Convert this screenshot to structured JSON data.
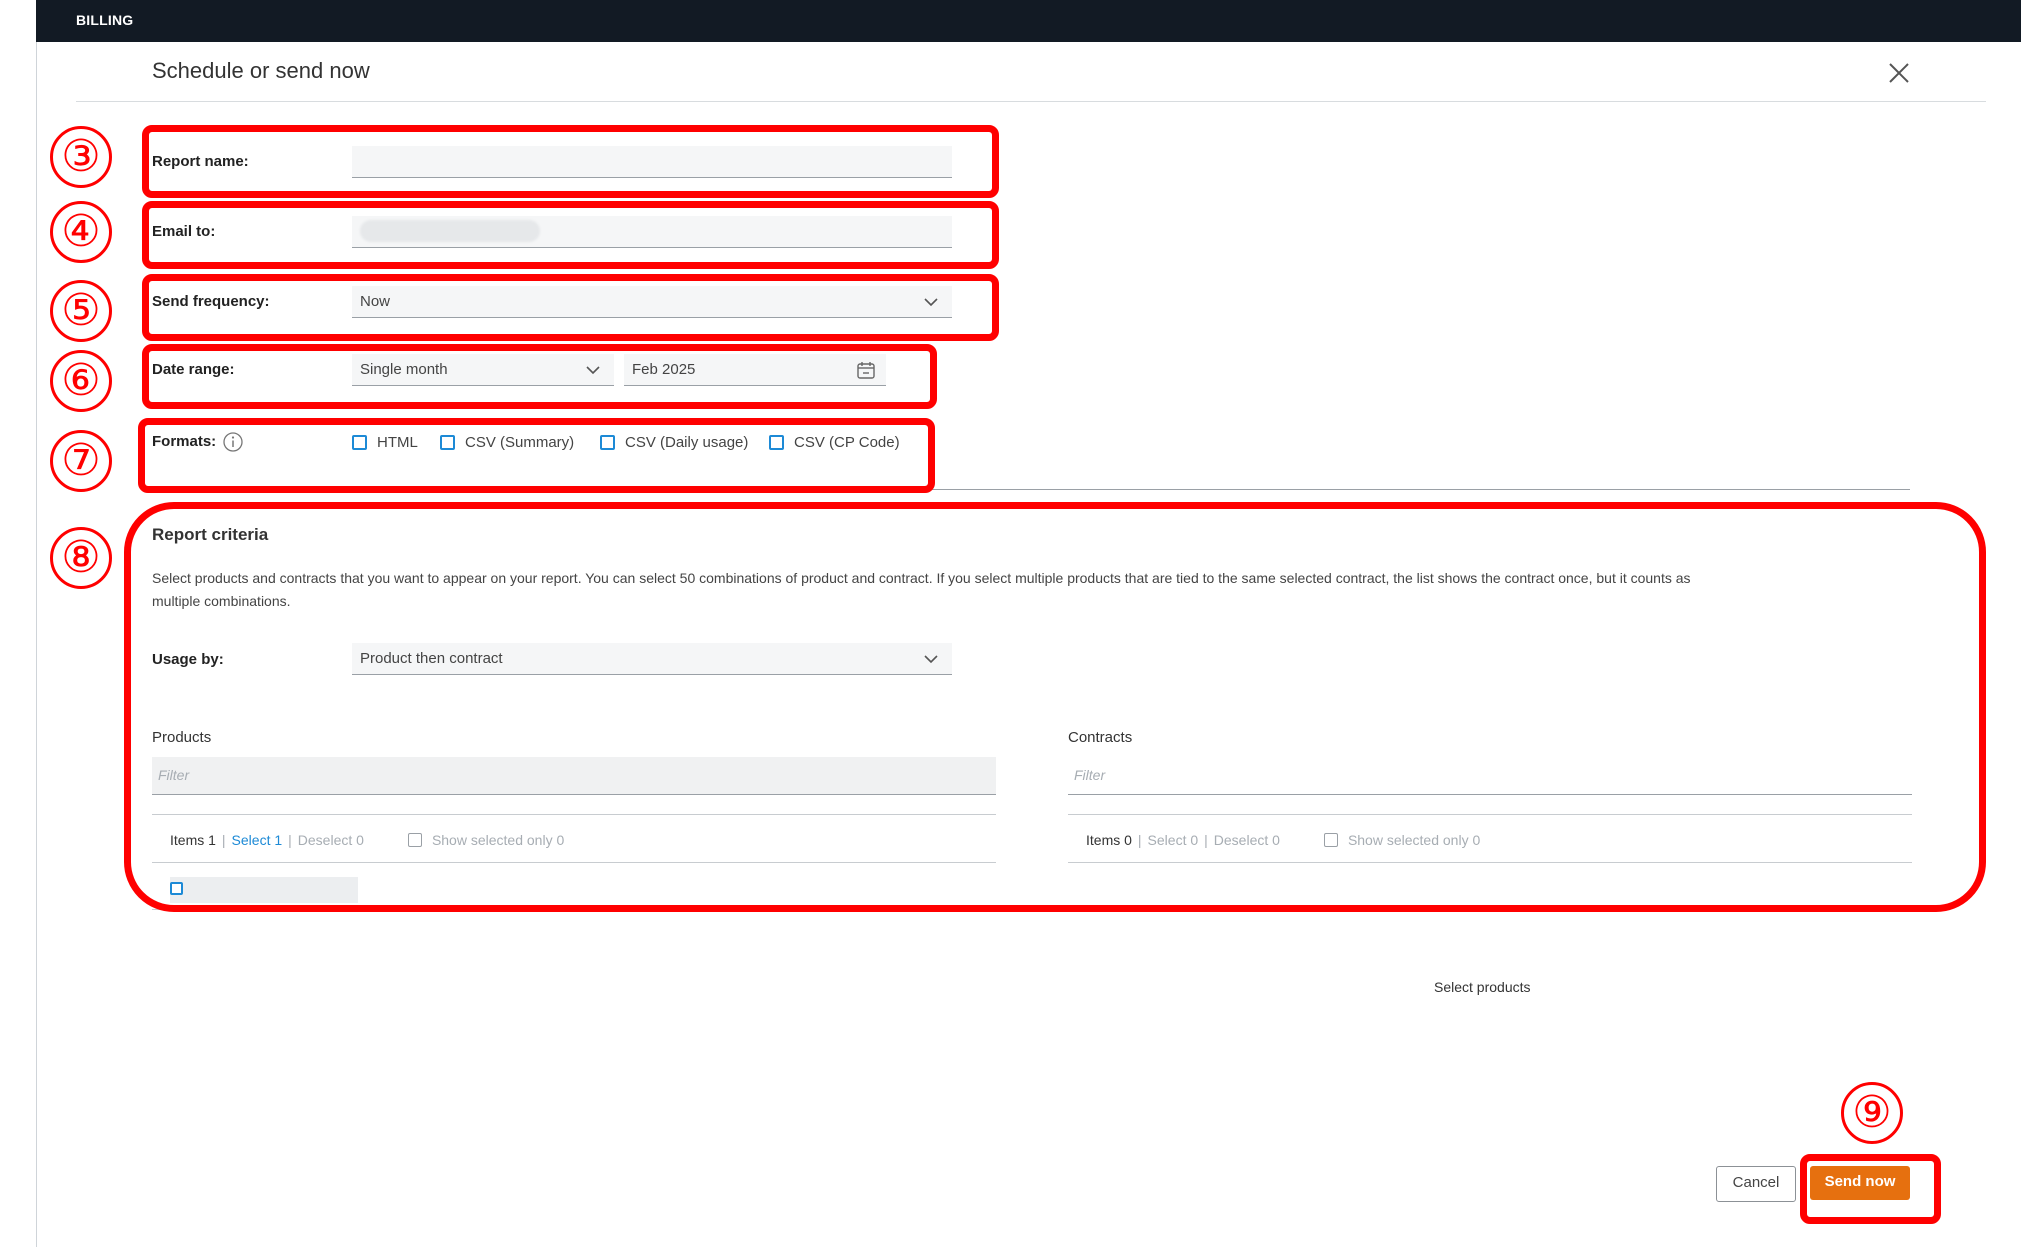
{
  "app": {
    "section_label": "BILLING"
  },
  "dialog": {
    "title": "Schedule or send now"
  },
  "form": {
    "report_name": {
      "label": "Report name:",
      "value": ""
    },
    "email_to": {
      "label": "Email to:"
    },
    "send_frequency": {
      "label": "Send frequency:",
      "value": "Now"
    },
    "date_range": {
      "label": "Date range:",
      "type_value": "Single month",
      "month_value": "Feb 2025"
    },
    "formats": {
      "label": "Formats:",
      "options": [
        "HTML",
        "CSV (Summary)",
        "CSV (Daily usage)",
        "CSV (CP Code)"
      ]
    }
  },
  "criteria": {
    "title": "Report criteria",
    "description_line1": "Select products and contracts that you want to appear on your report. You can select 50 combinations of product and contract. If you select multiple products that are tied to the same selected contract, the list shows the contract once, but it counts as",
    "description_line2": "multiple combinations.",
    "usage_by": {
      "label": "Usage by:",
      "value": "Product then contract"
    },
    "products": {
      "title": "Products",
      "filter_placeholder": "Filter",
      "items": "Items 1",
      "select": "Select 1",
      "deselect": "Deselect 0",
      "show_selected": "Show selected only 0"
    },
    "contracts": {
      "title": "Contracts",
      "filter_placeholder": "Filter",
      "items": "Items 0",
      "select": "Select 0",
      "deselect": "Deselect 0",
      "show_selected": "Show selected only 0",
      "empty_text": "Select products"
    }
  },
  "footer": {
    "cancel_label": "Cancel",
    "send_label": "Send now"
  },
  "annotations": [
    "③",
    "④",
    "⑤",
    "⑥",
    "⑦",
    "⑧",
    "⑨"
  ],
  "colors": {
    "annotation": "#ff0000",
    "accent": "#1d8ad6",
    "send_button": "#e6700f",
    "topbar": "#121a24"
  },
  "icons": {
    "close": "close-icon",
    "chevron": "chevron-down-icon",
    "calendar": "calendar-icon",
    "info": "info-icon"
  }
}
